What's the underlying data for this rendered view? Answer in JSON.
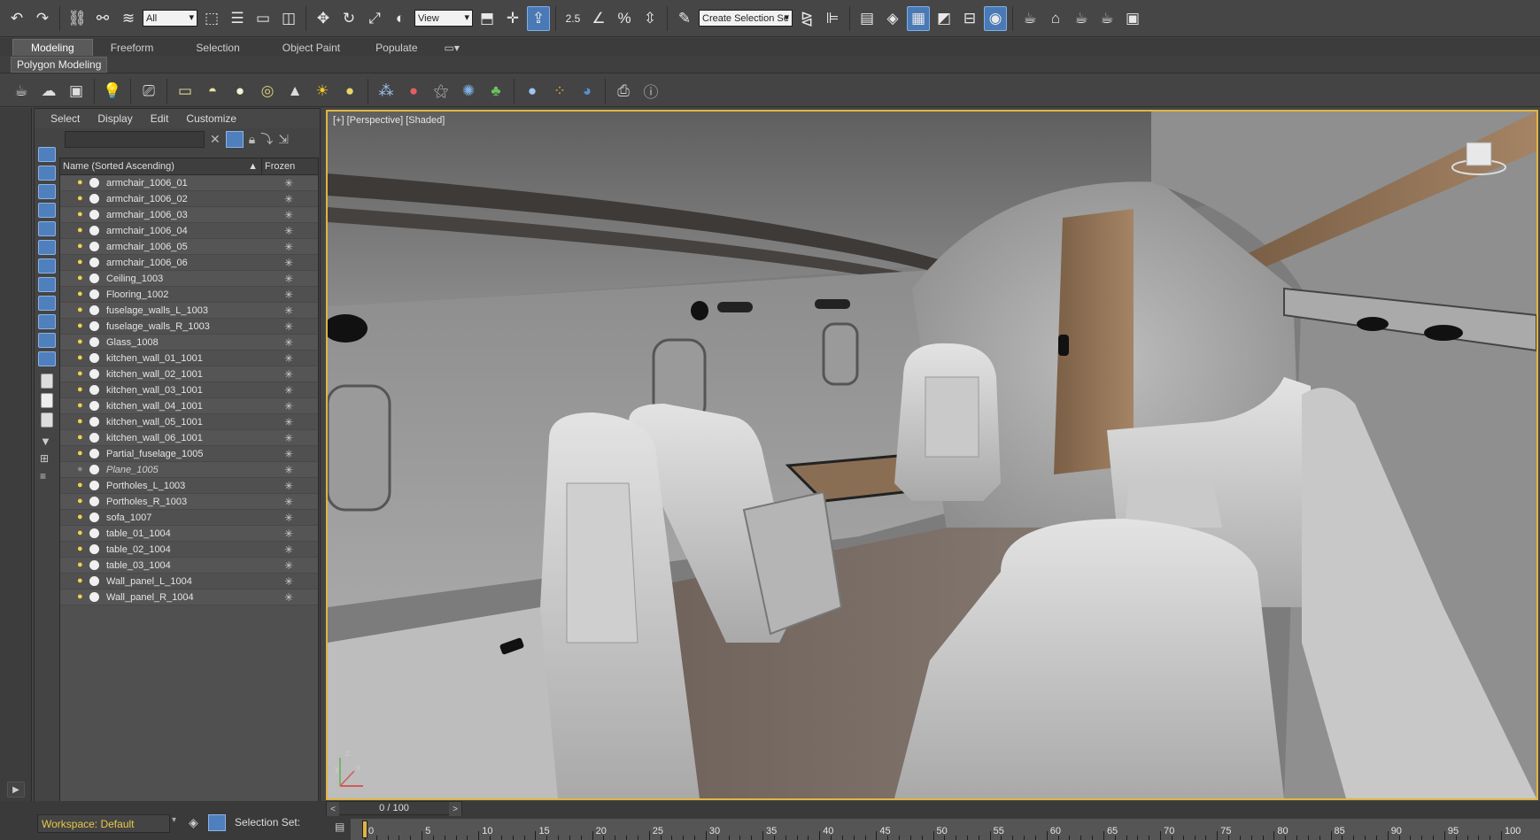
{
  "toolbar": {
    "filter_select": "All",
    "view_select": "View",
    "snap_angle": "2.5",
    "selection_set_placeholder": "Create Selection Se"
  },
  "ribbon": {
    "tabs": [
      "Modeling",
      "Freeform",
      "Selection",
      "Object Paint",
      "Populate"
    ],
    "active_tab": "Modeling",
    "sub_label": "Polygon Modeling"
  },
  "explorer": {
    "menu": [
      "Select",
      "Display",
      "Edit",
      "Customize"
    ],
    "columns": {
      "name": "Name (Sorted Ascending)",
      "frozen": "Frozen"
    },
    "objects": [
      {
        "name": "armchair_1006_01"
      },
      {
        "name": "armchair_1006_02"
      },
      {
        "name": "armchair_1006_03"
      },
      {
        "name": "armchair_1006_04"
      },
      {
        "name": "armchair_1006_05"
      },
      {
        "name": "armchair_1006_06"
      },
      {
        "name": "Ceiling_1003"
      },
      {
        "name": "Flooring_1002"
      },
      {
        "name": "fuselage_walls_L_1003"
      },
      {
        "name": "fuselage_walls_R_1003"
      },
      {
        "name": "Glass_1008"
      },
      {
        "name": "kitchen_wall_01_1001"
      },
      {
        "name": "kitchen_wall_02_1001"
      },
      {
        "name": "kitchen_wall_03_1001"
      },
      {
        "name": "kitchen_wall_04_1001"
      },
      {
        "name": "kitchen_wall_05_1001"
      },
      {
        "name": "kitchen_wall_06_1001"
      },
      {
        "name": "Partial_fuselage_1005"
      },
      {
        "name": "Plane_1005",
        "hidden": true
      },
      {
        "name": "Portholes_L_1003"
      },
      {
        "name": "Portholes_R_1003"
      },
      {
        "name": "sofa_1007"
      },
      {
        "name": "table_01_1004"
      },
      {
        "name": "table_02_1004"
      },
      {
        "name": "table_03_1004"
      },
      {
        "name": "Wall_panel_L_1004"
      },
      {
        "name": "Wall_panel_R_1004"
      }
    ]
  },
  "viewport": {
    "label": "[+] [Perspective] [Shaded]",
    "axis_x": "x",
    "axis_y": "y",
    "axis_z": "z"
  },
  "timeline": {
    "frame": "0 / 100",
    "prev": "<",
    "next": ">",
    "ticks": [
      "0",
      "5",
      "10",
      "15",
      "20",
      "25",
      "30",
      "35",
      "40",
      "45",
      "50",
      "55",
      "60",
      "65",
      "70",
      "75",
      "80",
      "85",
      "90",
      "95",
      "100"
    ]
  },
  "status": {
    "workspace": "Workspace: Default",
    "selection_sets": "Selection Set:"
  },
  "colors": {
    "accent": "#4f7fbd",
    "viewport_border": "#e0b542",
    "bulb": "#f2d24a"
  }
}
